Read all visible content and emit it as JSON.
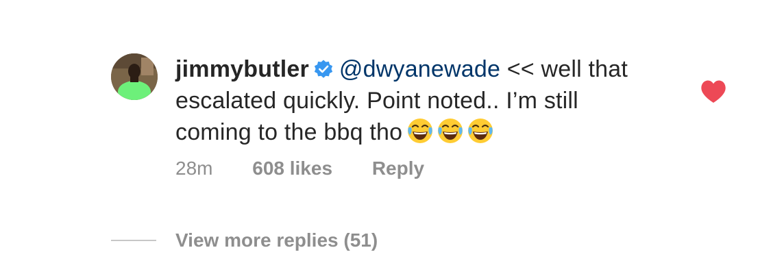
{
  "comment": {
    "username": "jimmybutler",
    "verified": true,
    "mention": "@dwyanewade",
    "text": " << well that escalated quickly. Point noted.. I’m still coming to the bbq tho",
    "emojis": [
      "face-with-tears-of-joy",
      "face-with-tears-of-joy",
      "face-with-tears-of-joy"
    ],
    "timestamp": "28m",
    "likes": "608 likes",
    "reply_label": "Reply",
    "liked": true,
    "view_more_replies": "View more replies (51)"
  },
  "colors": {
    "text": "#262626",
    "mention": "#003569",
    "meta": "#8e8e8e",
    "heart": "#ed4956",
    "verified": "#3897f0"
  }
}
